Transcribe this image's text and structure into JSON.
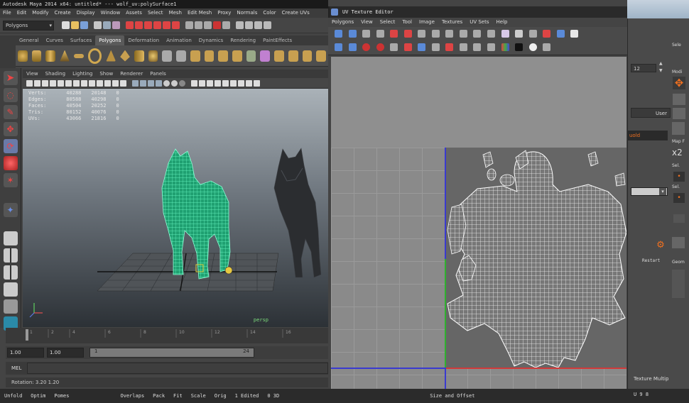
{
  "maya": {
    "title": "Autodesk Maya 2014 x64: untitled*   ---   wolf_uv:polySurface1",
    "menus": [
      "File",
      "Edit",
      "Modify",
      "Create",
      "Display",
      "Window",
      "Assets",
      "Select",
      "Mesh",
      "Edit Mesh",
      "Proxy",
      "Normals",
      "Color",
      "Create UVs"
    ],
    "mode_dropdown": "Polygons",
    "shelf_tabs": [
      "General",
      "Curves",
      "Surfaces",
      "Polygons",
      "Deformation",
      "Animation",
      "Dynamics",
      "Rendering",
      "PaintEffects"
    ],
    "active_shelf_tab": "Polygons",
    "panel_menus": [
      "View",
      "Shading",
      "Lighting",
      "Show",
      "Renderer",
      "Panels"
    ],
    "hud": {
      "rows": [
        {
          "label": "Verts:",
          "a": "40288",
          "b": "20148",
          "c": "0"
        },
        {
          "label": "Edges:",
          "a": "80588",
          "b": "40298",
          "c": "0"
        },
        {
          "label": "Faces:",
          "a": "40504",
          "b": "20252",
          "c": "0"
        },
        {
          "label": "Tris:",
          "a": "80152",
          "b": "40076",
          "c": "0"
        },
        {
          "label": "UVs:",
          "a": "43066",
          "b": "21816",
          "c": "0"
        }
      ]
    },
    "camera_label": "persp",
    "timeslider_ticks": [
      "1",
      "2",
      "4",
      "6",
      "8",
      "10",
      "12",
      "14",
      "16"
    ],
    "range": {
      "start": "1.00",
      "start2": "1.00",
      "frame_a": "1",
      "frame_b": "24"
    },
    "cmd_label": "MEL",
    "help_line": "Rotation:   3.20     1.20"
  },
  "uv_editor": {
    "title": "UV Texture Editor",
    "menus": [
      "Polygons",
      "View",
      "Select",
      "Tool",
      "Image",
      "Textures",
      "UV Sets",
      "Help"
    ]
  },
  "right_panel": {
    "labels": [
      "Sele",
      "Modi",
      "Map F",
      "x2",
      "Sel.",
      "Sel.",
      "Geom"
    ],
    "field_12": "12",
    "user_label": "User",
    "uold_label": "uold",
    "restart_label": "Restart"
  },
  "bottom_bar": {
    "items": [
      "Unfold",
      "Optim",
      "Pomes",
      "Overlaps",
      "Pack",
      "Fit",
      "Scale",
      "Orig",
      "1 Edited",
      "0 3D",
      "Size and Offset"
    ],
    "texture_label": "Texture Multip",
    "extra": "U 9 8"
  },
  "colors": {
    "wireframe": "#44f0b0",
    "uv_wire": "#ffffff",
    "uv_bg": "#8a8a8a"
  }
}
